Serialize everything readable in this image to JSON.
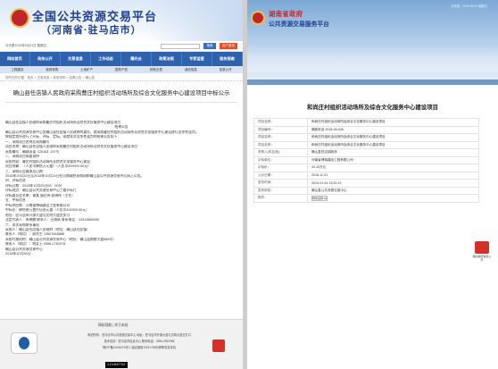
{
  "left": {
    "header": {
      "title": "全国公共资源交易平台",
      "subtitle": "（河南省·驻马店市）"
    },
    "search": {
      "date_text": "今天是2019年6月21日 星期五",
      "search_button": "搜索",
      "login_button": "用户登录"
    },
    "nav": [
      "网站首页",
      "政务公开",
      "交易信息",
      "工作动态",
      "曝光台",
      "政策法规",
      "专家监督",
      "服务指南"
    ],
    "subnav": [
      "工程建设",
      "政府采购",
      "土地矿产",
      "国有产权",
      "其他交易",
      "诚信信息",
      "信息公开"
    ],
    "breadcrumb": "您所在的位置：首页 > 交易信息 > 政府采购 > 结果公告 > 确山县",
    "doc_title": "确山县任店镇人民政府采购曹庄村组织活动场所及综合文化服务中心建设项目中标公示",
    "lines": [
      "确山县任店镇人民政府采购曹庄村组织活动场所及综合文化服务中心建设项目",
      "结果公告",
      "    确山县公共资源交易中心受确山县任店镇人民政府的委托，就采购曹庄村组织活动场所及综合文化服务中心建设进行竞争性谈判，",
      "按规定程序进行了开标、评标、定标。现就本次竞争性谈判的结果公告如下：",
      "一、采购项目名称及采购编号",
      "    项目名称：确山县任店镇人民政府采购曹庄村组织活动场所及综合文化服务中心建设项目",
      "    采购编号：确政采谈【2018】157号",
      "二、采购项目简要说明",
      "    采购内容：曹庄村组织活动场所及综合文化服务中心建设",
      "    项目预算：（人民币肆拾万元整）（人民币400000.00元）",
      "三、采购公告媒体及日期",
      "    2018年10月22日至2018年10月24日在河南政府采购网和确山县公共资源交易中心网上公告。",
      "四、评标信息",
      "    评标日期：2018年10月25日09：00分",
      "    评标地点：确山县公共资源交易中心三楼开标厅",
      "    评标委员会名单：谢某 唐红伟 薛海伟（主任）",
      "五、中标信息",
      "    中标供应商：河南省博瑞建设工程有限公司",
      "    中标价：肆拾叁万壹仟伍佰元整（人民币431500.00元）",
      "    地址：驻马店市开源大道与文明大道交叉口",
      "    法定代表人：朱晓鹏  联系人：吕海燕  联系电话：13313865090",
      "六、本次采购联系事项",
      "    采购人：确山县任店镇人民政府（地址：确山县任店镇）",
      "    联系人（电话）：薛先生  13507648888",
      "    采购代理机构：确山县公共资源交易中心（地址：确山县朗陵大道988号）",
      "    联系人（电话）：胡女士  0396-2762978",
      "                    确山县公共资源交易中心",
      "                    2018年10月26日"
    ],
    "footer": {
      "nav": "网站导航  |  关于本站",
      "lines": [
        "网站所有：驻马店市公共资源交易中心  地址：驻马店市开源大道与文明大道交叉口",
        "技术支持：驻马店市信息中心  联系电话：0396-2922958",
        "豫ICP备11004476号-1  建议使用1024×768分辨率浏览本站"
      ],
      "counter": "12488752"
    }
  },
  "right": {
    "header": {
      "title": "湖南省政府",
      "subtitle": "公共资源交易服务平台",
      "info": "今天是：2019-06-21  星期五"
    },
    "project_title": "和尚庄村组织活动场所及综合文化服务中心建设项目",
    "table": [
      {
        "k": "项目名称：",
        "v": "和尚庄村组织活动场所及综合文化服务中心建设项目"
      },
      {
        "k": "项目编号：",
        "v": "确政采谈 2018-06-046"
      },
      {
        "k": "项目名称：",
        "v": "和尚庄村组织活动场所及综合文化服务中心建设项目"
      },
      {
        "k": "项目名称：",
        "v": "和尚庄村组织活动场所及综合文化服务中心建设项目"
      },
      {
        "k": "采购人(供应商)：",
        "v": "确山县任店镇政府"
      },
      {
        "k": "中标单位：",
        "v": "河南省博瑞建设工程有限公司"
      },
      {
        "k": "中标价：",
        "v": "43.15万元"
      },
      {
        "k": "公示日期：",
        "v": "2018-11-01"
      },
      {
        "k": "发布时间：",
        "v": "2019-01-04 13:20:19"
      },
      {
        "k": "发布机构：",
        "v": "确山县公共资源交易中心"
      },
      {
        "k": "附件：",
        "v": "附件名称.rar"
      }
    ],
    "attach_label": "附件"
  },
  "float_label": "我的政府信息公开"
}
